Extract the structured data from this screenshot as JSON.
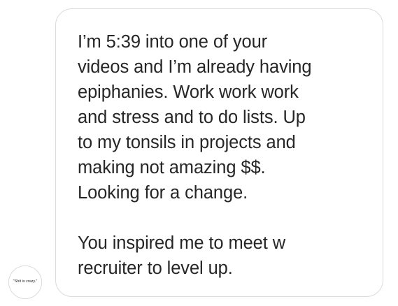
{
  "avatar": {
    "label": "\"Shit is crazy.\""
  },
  "message": {
    "lines": [
      "I’m 5:39 into one of your",
      "videos and I’m already having",
      "epiphanies. Work work work",
      "and stress and to do lists. Up",
      "to my tonsils in projects and",
      "making not amazing $$.",
      "Looking for a change.",
      "",
      "You inspired me to meet w",
      "recruiter to level up."
    ]
  },
  "colors": {
    "text": "#262626",
    "border": "#dbdbdb",
    "background": "#ffffff"
  }
}
